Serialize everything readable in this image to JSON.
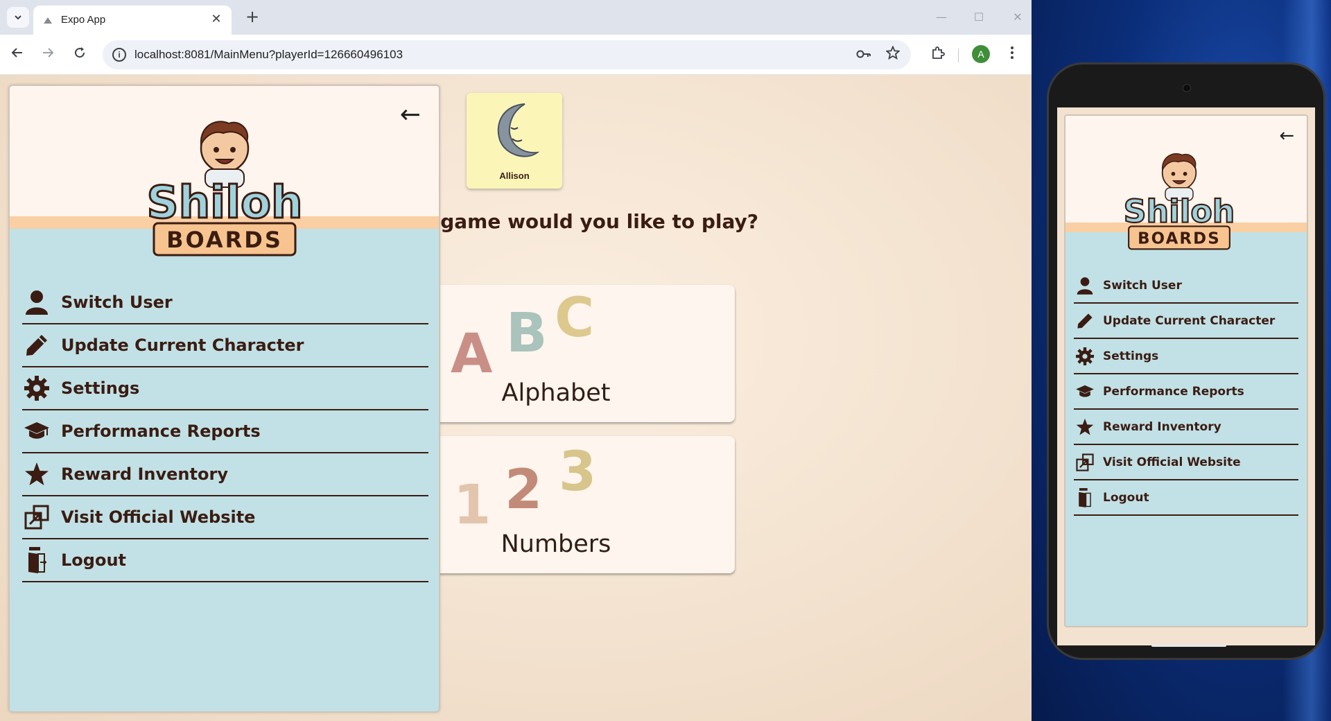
{
  "browser": {
    "tab_title": "Expo App",
    "url": "localhost:8081/MainMenu?playerId=126660496103",
    "profile_initial": "A",
    "new_tab_symbol": "+",
    "close_symbol": "✕",
    "window_controls": {
      "minimize": "—",
      "maximize": "☐",
      "close": "✕"
    }
  },
  "page": {
    "player_name": "Allison",
    "question": "! Which game would you like to play?",
    "games": [
      {
        "label": "Alphabet",
        "glyphs": [
          "A",
          "B",
          "C"
        ]
      },
      {
        "label": "Numbers",
        "glyphs": [
          "1",
          "2",
          "3"
        ]
      }
    ]
  },
  "drawer": {
    "back_symbol": "←",
    "logo_text_top": "Shiloh",
    "logo_text_bottom": "BOARDS",
    "items": [
      {
        "label": "Switch User",
        "icon": "user-icon"
      },
      {
        "label": "Update Current Character",
        "icon": "pencil-icon"
      },
      {
        "label": "Settings",
        "icon": "gear-icon"
      },
      {
        "label": "Performance Reports",
        "icon": "graduation-cap-icon"
      },
      {
        "label": "Reward Inventory",
        "icon": "star-icon"
      },
      {
        "label": "Visit Official Website",
        "icon": "external-link-icon"
      },
      {
        "label": "Logout",
        "icon": "exit-door-icon"
      }
    ]
  },
  "colors": {
    "drawer_bg": "#c1e1e6",
    "drawer_header": "#fdf5ee",
    "accent_peach": "#f9cfa3",
    "text_brown": "#3b1c12",
    "avatar_card": "#fbf6b8"
  }
}
